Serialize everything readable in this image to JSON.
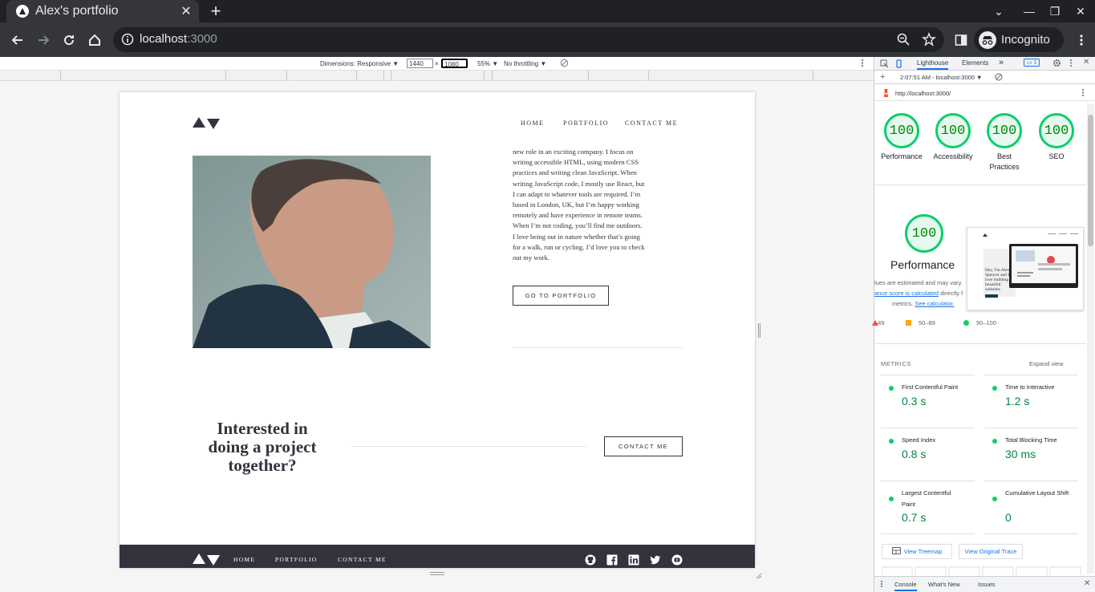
{
  "browser": {
    "tab_title": "Alex's portfolio",
    "new_tab": "+",
    "url_host": "localhost",
    "url_port": ":3000",
    "profile_label": "Incognito"
  },
  "device_toolbar": {
    "dimensions_label": "Dimensions: Responsive ▼",
    "width": "1440",
    "x": "×",
    "height": "1080",
    "zoom": "55% ▼",
    "throttle": "No throttling ▼"
  },
  "site": {
    "nav": [
      "HOME",
      "PORTFOLIO",
      "CONTACT ME"
    ],
    "about_lines": [
      "new role in an exciting company. I focus on",
      "writing accessible HTML, using modern CSS",
      "practices and writing clean JavaScript. When",
      "writing JavaScript code, I mostly use React, but",
      "I can adapt to whatever tools are required. I’m",
      "based in London, UK, but I’m happy working",
      "remotely and have experience in remote teams.",
      "When I’m not coding, you’ll find me outdoors.",
      "I love being out in nature whether that’s going",
      "for a walk, run or cycling. I’d love you to check",
      "out my work."
    ],
    "portfolio_button": "GO TO PORTFOLIO",
    "cta_heading": "Interested in doing a project together?",
    "contact_button": "CONTACT ME",
    "footer_nav": [
      "HOME",
      "PORTFOLIO",
      "CONTACT ME"
    ],
    "social_icons": [
      "github-icon",
      "facebook-icon",
      "linkedin-icon",
      "twitter-icon",
      "youtube-icon"
    ]
  },
  "devtools": {
    "tabs": [
      "Lighthouse",
      "Elements"
    ],
    "more_tabs": "»",
    "issues_badge": "1",
    "report_time": "2:07:51 AM - localhost:3000 ▼",
    "report_url": "http://localhost:3000/",
    "scores": [
      {
        "label": "Performance",
        "value": "100"
      },
      {
        "label": "Accessibility",
        "value": "100"
      },
      {
        "label": "Best Practices",
        "value": "100"
      },
      {
        "label": "SEO",
        "value": "100"
      }
    ],
    "perf_score": "100",
    "perf_title": "Performance",
    "perf_note_1": "lues are estimated and may vary.",
    "perf_note_2_link": "ance score is calculated",
    "perf_note_2_text": " directly f",
    "perf_note_3_text": "metrics. ",
    "perf_note_3_link": "See calculator.",
    "legend": [
      {
        "label": "–49",
        "color": "#ff4e42"
      },
      {
        "label": "50–89",
        "color": "#ffa400"
      },
      {
        "label": "90–100",
        "color": "#0cce6b"
      }
    ],
    "metrics_title": "METRICS",
    "expand_view": "Expand view",
    "metrics": [
      {
        "label": "First Contentful Paint",
        "value": "0.3 s"
      },
      {
        "label": "Time to Interactive",
        "value": "1.2 s"
      },
      {
        "label": "Speed Index",
        "value": "0.8 s"
      },
      {
        "label": "Total Blocking Time",
        "value": "30 ms"
      },
      {
        "label": "Largest Contentful Paint",
        "value": "0.7 s"
      },
      {
        "label": "Cumulative Layout Shift",
        "value": "0"
      }
    ],
    "view_treemap": "View Treemap",
    "view_trace": "View Original Trace",
    "drawer_tabs": [
      "Console",
      "What's New",
      "Issues"
    ]
  },
  "colors": {
    "dark": "#33323d",
    "score_green": "#0cce6b",
    "score_text": "#008800"
  }
}
